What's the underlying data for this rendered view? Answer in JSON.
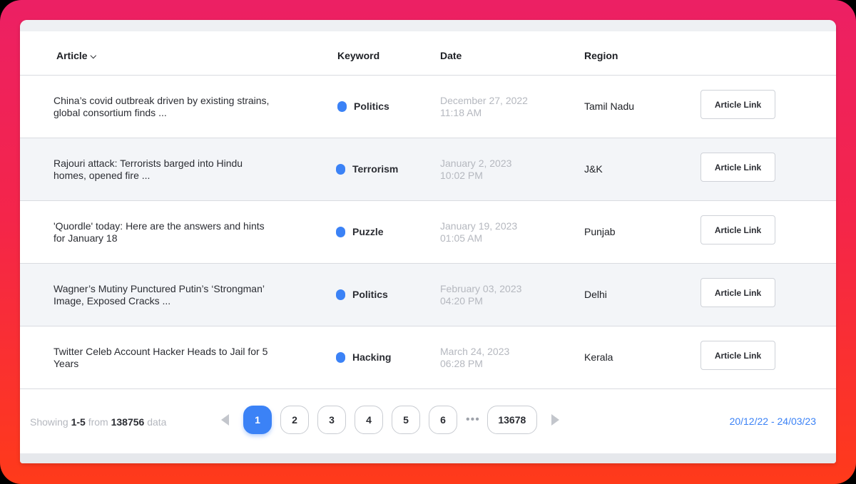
{
  "columns": {
    "article": "Article",
    "keyword": "Keyword",
    "date": "Date",
    "region": "Region"
  },
  "rows": [
    {
      "article_line1": "China’s covid outbreak driven by existing strains,",
      "article_line2": "global consortium finds ...",
      "keyword": "Politics",
      "date": "December 27, 2022",
      "time": "11:18 AM",
      "region": "Tamil Nadu",
      "link": "Article Link"
    },
    {
      "article_line1": "Rajouri attack: Terrorists barged into Hindu",
      "article_line2": "homes, opened fire ...",
      "keyword": "Terrorism",
      "date": "January 2, 2023",
      "time": "10:02 PM",
      "region": "J&K",
      "link": "Article Link"
    },
    {
      "article_line1": "'Quordle' today: Here are the answers and hints",
      "article_line2": "for January 18",
      "keyword": "Puzzle",
      "date": "January 19, 2023",
      "time": "01:05 AM",
      "region": "Punjab",
      "link": "Article Link"
    },
    {
      "article_line1": "Wagner’s Mutiny Punctured Putin’s ‘Strongman’",
      "article_line2": "Image, Exposed Cracks ...",
      "keyword": "Politics",
      "date": "February 03, 2023",
      "time": "04:20 PM",
      "region": "Delhi",
      "link": "Article Link"
    },
    {
      "article_line1": "Twitter Celeb Account Hacker Heads to Jail for 5",
      "article_line2": "Years",
      "keyword": "Hacking",
      "date": "March 24, 2023",
      "time": "06:28 PM",
      "region": "Kerala",
      "link": "Article Link"
    }
  ],
  "footer": {
    "showing_prefix": "Showing",
    "showing_range": "1-5",
    "showing_from": "from",
    "showing_total": "138756",
    "showing_suffix": "data",
    "pages": [
      "1",
      "2",
      "3",
      "4",
      "5",
      "6"
    ],
    "ellipsis": "•••",
    "last_page": "13678",
    "active_page": "1",
    "date_range": "20/12/22 - 24/03/23"
  },
  "colors": {
    "accent": "#3b82f6",
    "frame_top": "#ec2064",
    "frame_bottom": "#ff3a1a"
  },
  "icons": {
    "sort": "chevron-down-icon",
    "prev": "caret-left-icon",
    "next": "caret-right-icon",
    "keyword_dot": "dot-icon"
  }
}
